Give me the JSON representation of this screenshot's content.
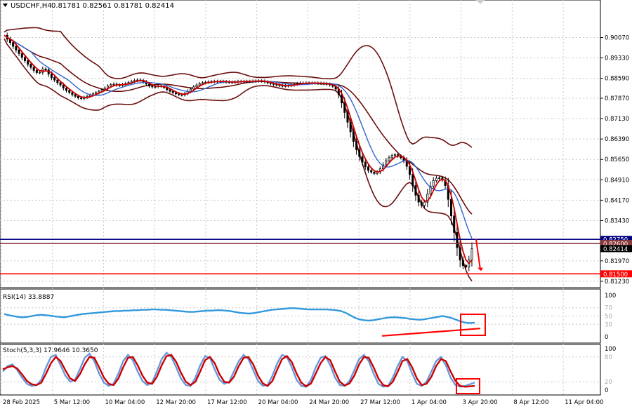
{
  "header": {
    "symbol": "USDCHF,H4",
    "ohlc": "0.81781 0.82561 0.81781 0.82414"
  },
  "colors": {
    "candle": "#000000",
    "ma_red": "#cc0000",
    "ma_blue": "#3366cc",
    "ma_dark": "#660000",
    "bollinger": "#6b0f0f",
    "hline_blue": "#000080",
    "hline_brown": "#8b3a3a",
    "hline_red": "#ff0000",
    "rsi_line": "#3399dd",
    "stoch_main": "#6699dd",
    "stoch_signal": "#cc0000",
    "highlight": "#ff0000",
    "grid": "#c8c8c8"
  },
  "chart_data": [
    {
      "type": "line",
      "name": "price",
      "title": "USDCHF,H4",
      "ylim": [
        0.8105,
        0.9133
      ],
      "y_ticks": [
        "0.90070",
        "0.89330",
        "0.88590",
        "0.87870",
        "0.87130",
        "0.86390",
        "0.85650",
        "0.84910",
        "0.84170",
        "0.83430",
        "0.81970",
        "0.81230"
      ],
      "x_ticks": [
        "28 Feb 2025",
        "5 Mar 12:00",
        "10 Mar 04:00",
        "12 Mar 20:00",
        "17 Mar 12:00",
        "20 Mar 04:00",
        "24 Mar 20:00",
        "27 Mar 12:00",
        "1 Apr 04:00",
        "3 Apr 20:00",
        "8 Apr 12:00",
        "11 Apr 04:00"
      ],
      "horizontal_levels": [
        {
          "label": "0.82750",
          "value": 0.8275,
          "color": "#000080"
        },
        {
          "label": "0.82600",
          "value": 0.826,
          "color": "#8b3a3a"
        },
        {
          "label": "0.81500",
          "value": 0.815,
          "color": "#ff0000"
        }
      ],
      "current_price_label": "0.82414",
      "current_price": 0.82414,
      "close_series": [
        0.9015,
        0.9001,
        0.8989,
        0.8975,
        0.8962,
        0.8949,
        0.8935,
        0.8923,
        0.891,
        0.8899,
        0.8888,
        0.888,
        0.8881,
        0.8893,
        0.889,
        0.8875,
        0.8862,
        0.8853,
        0.8843,
        0.8835,
        0.8824,
        0.8815,
        0.8808,
        0.88,
        0.8794,
        0.8788,
        0.8786,
        0.879,
        0.8794,
        0.8798,
        0.8803,
        0.8807,
        0.8812,
        0.8818,
        0.8824,
        0.8831,
        0.8836,
        0.8838,
        0.8835,
        0.8834,
        0.8837,
        0.884,
        0.8844,
        0.8848,
        0.8851,
        0.8853,
        0.8852,
        0.8846,
        0.8838,
        0.8831,
        0.8828,
        0.8829,
        0.8832,
        0.8831,
        0.8826,
        0.8818,
        0.8812,
        0.8807,
        0.8803,
        0.88,
        0.8799,
        0.8804,
        0.8812,
        0.882,
        0.8828,
        0.8835,
        0.884,
        0.8843,
        0.8845,
        0.8846,
        0.8847,
        0.8848,
        0.8848,
        0.8848,
        0.8847,
        0.8846,
        0.8845,
        0.8845,
        0.8846,
        0.8848,
        0.8848,
        0.8848,
        0.8848,
        0.8848,
        0.8849,
        0.885,
        0.885,
        0.8849,
        0.8846,
        0.8843,
        0.884,
        0.8837,
        0.8835,
        0.8833,
        0.8832,
        0.8832,
        0.8833,
        0.8835,
        0.8838,
        0.884,
        0.8842,
        0.8842,
        0.8842,
        0.8842,
        0.8842,
        0.8842,
        0.8841,
        0.8841,
        0.884,
        0.8838,
        0.8835,
        0.883,
        0.882,
        0.88,
        0.877,
        0.8735,
        0.87,
        0.8665,
        0.863,
        0.86,
        0.8575,
        0.8555,
        0.8538,
        0.8525,
        0.8519,
        0.8514,
        0.852,
        0.8531,
        0.8545,
        0.856,
        0.8571,
        0.8579,
        0.8582,
        0.8577,
        0.8571,
        0.856,
        0.854,
        0.851,
        0.847,
        0.8435,
        0.841,
        0.8398,
        0.841,
        0.844,
        0.8468,
        0.8488,
        0.8497,
        0.8498,
        0.849,
        0.847,
        0.842,
        0.836,
        0.83,
        0.8245,
        0.82,
        0.818,
        0.8175,
        0.82,
        0.8241
      ]
    },
    {
      "type": "line",
      "name": "RSI(14)",
      "title": "RSI(14) 33.8887",
      "ylim": [
        0,
        100
      ],
      "y_ticks": [
        "100",
        "70",
        "50",
        "30",
        "0"
      ],
      "series": [
        {
          "name": "RSI(14)",
          "values": [
            55,
            52,
            50,
            48,
            47,
            48,
            50,
            52,
            53,
            52,
            51,
            49,
            48,
            47,
            49,
            51,
            53,
            55,
            56,
            57,
            58,
            59,
            60,
            61,
            62,
            62,
            63,
            63,
            64,
            64,
            65,
            65,
            66,
            66,
            65,
            65,
            64,
            63,
            62,
            61,
            60,
            60,
            61,
            62,
            63,
            63,
            64,
            64,
            63,
            62,
            60,
            58,
            57,
            56,
            57,
            59,
            61,
            63,
            65,
            66,
            67,
            68,
            69,
            69,
            68,
            67,
            66,
            66,
            66,
            66,
            66,
            65,
            64,
            62,
            58,
            52,
            46,
            42,
            40,
            39,
            40,
            42,
            44,
            46,
            47,
            47,
            46,
            45,
            43,
            42,
            41,
            42,
            44,
            46,
            48,
            50,
            48,
            45,
            41,
            37,
            34,
            33,
            34
          ]
        }
      ],
      "current_value": "33.8887"
    },
    {
      "type": "line",
      "name": "Stoch(5,3,3)",
      "title": "Stoch(5,3,3) 17.9646 10.3650",
      "ylim": [
        0,
        100
      ],
      "y_ticks": [
        "100",
        "80",
        "20",
        "0"
      ],
      "series": [
        {
          "name": "main",
          "values": [
            45,
            58,
            62,
            48,
            30,
            15,
            10,
            12,
            25,
            55,
            80,
            85,
            60,
            35,
            20,
            25,
            50,
            78,
            88,
            70,
            40,
            18,
            10,
            15,
            40,
            70,
            85,
            72,
            45,
            22,
            12,
            18,
            45,
            75,
            90,
            80,
            55,
            28,
            12,
            10,
            30,
            60,
            82,
            78,
            50,
            25,
            15,
            20,
            45,
            70,
            85,
            75,
            48,
            22,
            10,
            12,
            35,
            65,
            85,
            80,
            55,
            25,
            10,
            8,
            25,
            55,
            78,
            82,
            60,
            30,
            12,
            10,
            22,
            48,
            75,
            85,
            70,
            40,
            15,
            8,
            10,
            30,
            58,
            80,
            70,
            40,
            15,
            10,
            20,
            45,
            70,
            80,
            60,
            30,
            12,
            8,
            10,
            14,
            18
          ]
        },
        {
          "name": "signal",
          "values": [
            50,
            55,
            58,
            52,
            38,
            22,
            14,
            12,
            18,
            40,
            65,
            80,
            70,
            48,
            28,
            22,
            38,
            62,
            80,
            78,
            55,
            30,
            15,
            12,
            28,
            55,
            78,
            80,
            60,
            35,
            18,
            15,
            32,
            60,
            82,
            85,
            68,
            42,
            20,
            12,
            20,
            45,
            72,
            80,
            65,
            38,
            20,
            18,
            32,
            58,
            78,
            80,
            62,
            35,
            16,
            10,
            22,
            50,
            75,
            82,
            68,
            40,
            18,
            9,
            16,
            40,
            65,
            80,
            72,
            45,
            20,
            11,
            16,
            35,
            62,
            80,
            78,
            55,
            28,
            12,
            9,
            20,
            44,
            70,
            75,
            55,
            28,
            12,
            15,
            32,
            58,
            75,
            70,
            45,
            22,
            10,
            8,
            9,
            10
          ]
        }
      ],
      "current_values": [
        "17.9646",
        "10.3650"
      ]
    }
  ]
}
